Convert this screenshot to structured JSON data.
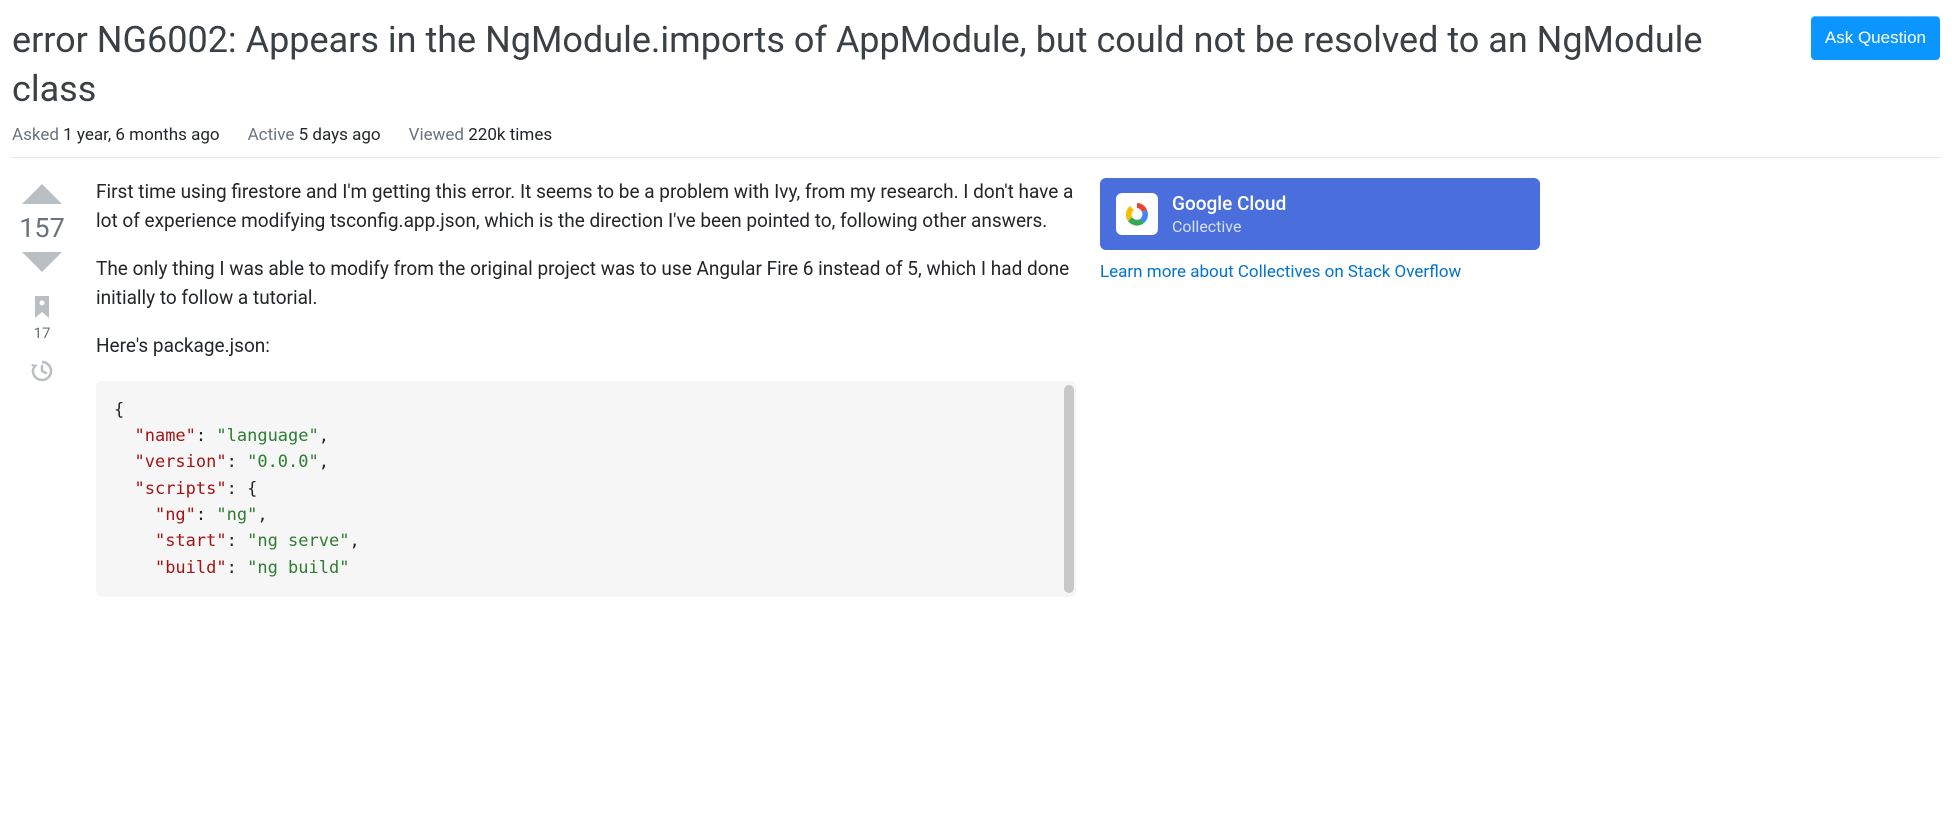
{
  "header": {
    "title": "error NG6002: Appears in the NgModule.imports of AppModule, but could not be resolved to an NgModule class",
    "ask_button": "Ask Question"
  },
  "meta": {
    "asked_label": "Asked",
    "asked_value": "1 year, 6 months ago",
    "active_label": "Active",
    "active_value": "5 days ago",
    "viewed_label": "Viewed",
    "viewed_value": "220k times"
  },
  "vote": {
    "score": "157",
    "bookmarks": "17"
  },
  "content": {
    "p1": "First time using firestore and I'm getting this error. It seems to be a problem with Ivy, from my research. I don't have a lot of experience modifying tsconfig.app.json, which is the direction I've been pointed to, following other answers.",
    "p2": "The only thing I was able to modify from the original project was to use Angular Fire 6 instead of 5, which I had done initially to follow a tutorial.",
    "p3": "Here's package.json:"
  },
  "code": {
    "open_brace": "{",
    "k_name": "\"name\"",
    "v_name": "\"language\"",
    "k_version": "\"version\"",
    "v_version": "\"0.0.0\"",
    "k_scripts": "\"scripts\"",
    "k_ng": "\"ng\"",
    "v_ng": "\"ng\"",
    "k_start": "\"start\"",
    "v_start": "\"ng serve\"",
    "k_build": "\"build\"",
    "v_build": "\"ng build\""
  },
  "collective": {
    "title": "Google Cloud",
    "subtitle": "Collective",
    "learn_link": "Learn more about Collectives on Stack Overflow"
  }
}
